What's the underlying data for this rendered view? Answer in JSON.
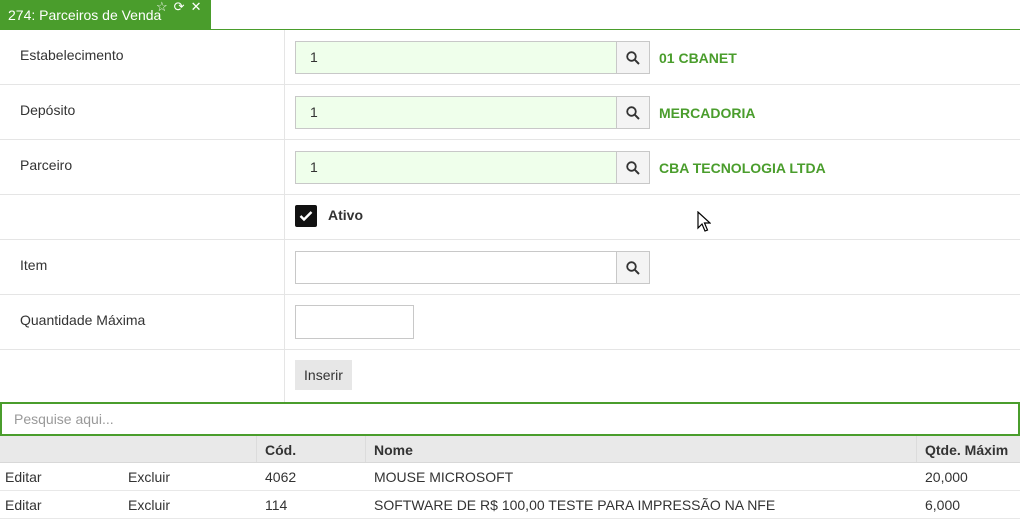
{
  "tab": {
    "title": "274: Parceiros de Venda"
  },
  "form": {
    "estabelecimento": {
      "label": "Estabelecimento",
      "value": "1",
      "description": "01 CBANET"
    },
    "deposito": {
      "label": "Depósito",
      "value": "1",
      "description": "MERCADORIA"
    },
    "parceiro": {
      "label": "Parceiro",
      "value": "1",
      "description": "CBA TECNOLOGIA LTDA"
    },
    "ativo": {
      "label": "Ativo",
      "checked": true
    },
    "item": {
      "label": "Item",
      "value": ""
    },
    "quantidade_maxima": {
      "label": "Quantidade Máxima",
      "value": ""
    },
    "inserir_label": "Inserir"
  },
  "search": {
    "placeholder": "Pesquise aqui..."
  },
  "grid": {
    "headers": {
      "cod": "Cód.",
      "nome": "Nome",
      "qtde": "Qtde. Máxim"
    },
    "rows": [
      {
        "edit": "Editar",
        "delete": "Excluir",
        "cod": "4062",
        "nome": "MOUSE MICROSOFT",
        "qtde": "20,000"
      },
      {
        "edit": "Editar",
        "delete": "Excluir",
        "cod": "114",
        "nome": "SOFTWARE DE R$ 100,00 TESTE PARA IMPRESSÃO NA NFE",
        "qtde": "6,000"
      }
    ]
  },
  "colors": {
    "accent": "#4a9d2c",
    "field_fill": "#efffeb"
  }
}
